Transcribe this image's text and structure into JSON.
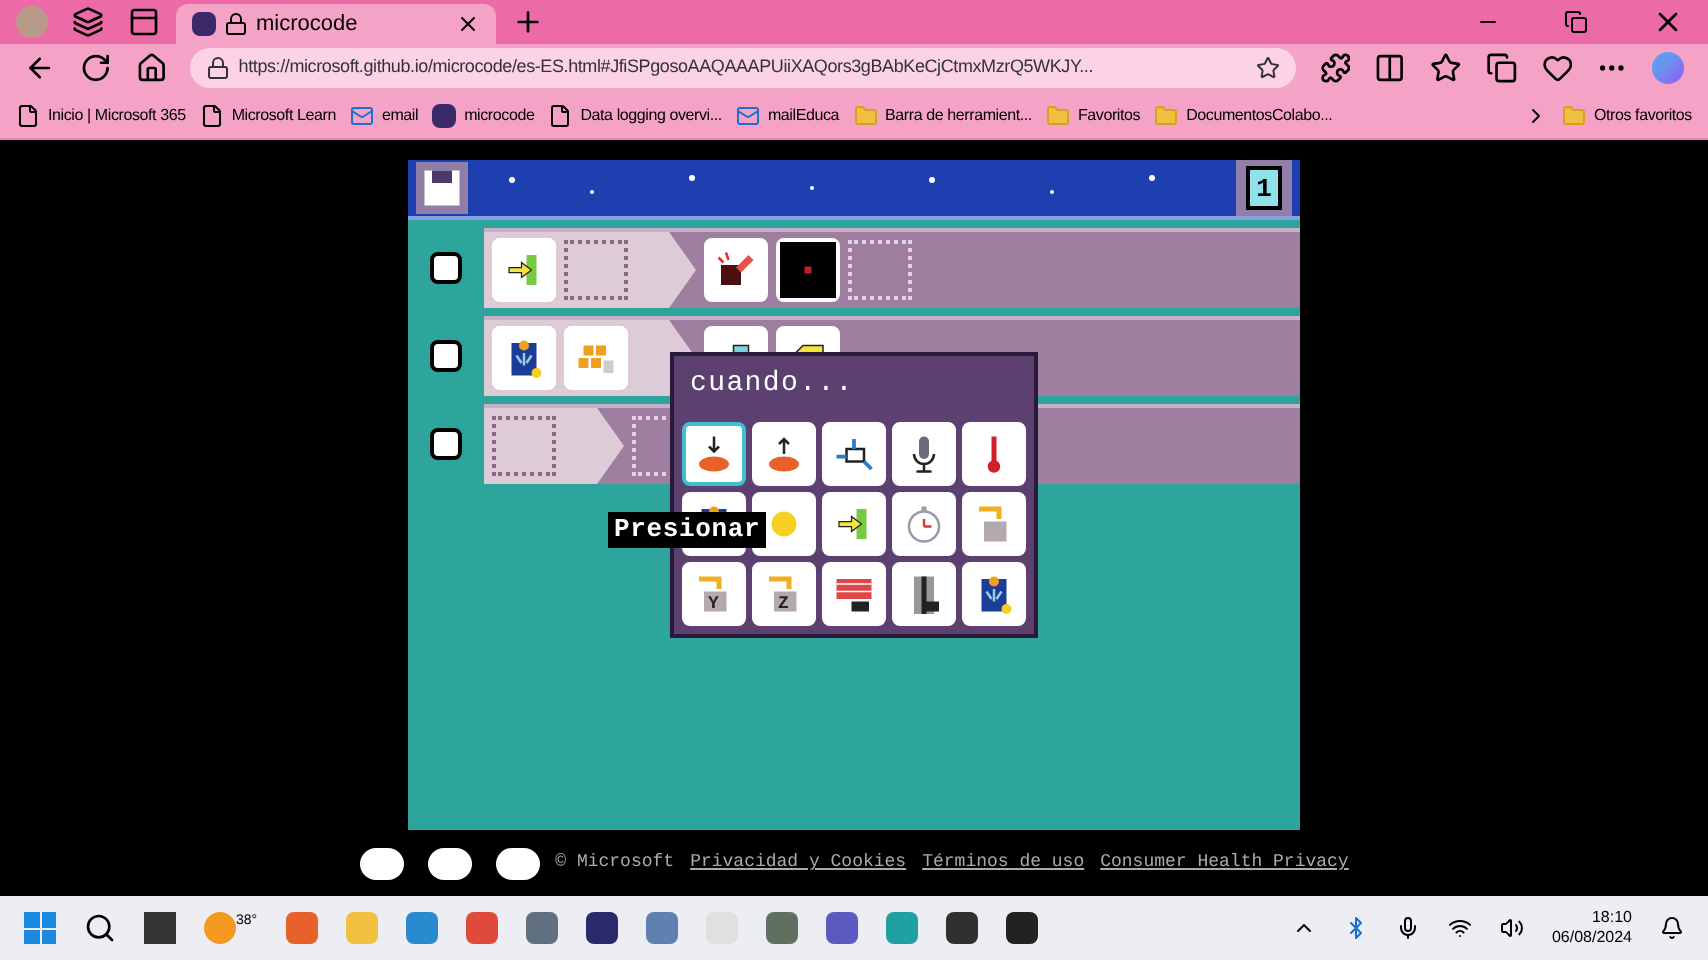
{
  "browser": {
    "tabs": [
      {
        "title": "microcode",
        "selected": true
      }
    ],
    "address": "https://microsoft.github.io/microcode/es-ES.html#JfiSPgosoAAQAAAPUiiXAQors3gBAbKeCjCtmxMzrQ5WKJY...",
    "bookmarks": [
      {
        "title": "Inicio | Microsoft 365",
        "kind": "page"
      },
      {
        "title": "Microsoft Learn",
        "kind": "page"
      },
      {
        "title": "email",
        "kind": "mail"
      },
      {
        "title": "microcode",
        "kind": "logo"
      },
      {
        "title": "Data logging overvi...",
        "kind": "page"
      },
      {
        "title": "mailEduca",
        "kind": "mail"
      },
      {
        "title": "Barra de herramient...",
        "kind": "folder"
      },
      {
        "title": "Favoritos",
        "kind": "folder"
      },
      {
        "title": "DocumentosColabo...",
        "kind": "folder"
      }
    ],
    "other_bookmarks": "Otros favoritos"
  },
  "editor": {
    "page_number": "1",
    "rules": [
      {
        "checked": false
      },
      {
        "checked": false
      },
      {
        "checked": false
      }
    ],
    "picker": {
      "title": "cuando...",
      "tiles": [
        {
          "selected": true
        },
        {
          "selected": false
        },
        {
          "selected": false
        },
        {
          "selected": false
        },
        {
          "selected": false
        },
        {
          "selected": false
        },
        {
          "selected": false
        },
        {
          "selected": false
        },
        {
          "selected": false
        },
        {
          "selected": false
        },
        {
          "selected": false,
          "label": "Y"
        },
        {
          "selected": false,
          "label": "Z"
        },
        {
          "selected": false
        },
        {
          "selected": false
        },
        {
          "selected": false
        }
      ]
    },
    "tooltip": "Presionar"
  },
  "footer": {
    "copyright": "© Microsoft",
    "links": [
      "Privacidad y Cookies",
      "Términos de uso",
      "Consumer Health Privacy"
    ]
  },
  "taskbar": {
    "weather": "38°",
    "time": "18:10",
    "date": "06/08/2024"
  }
}
